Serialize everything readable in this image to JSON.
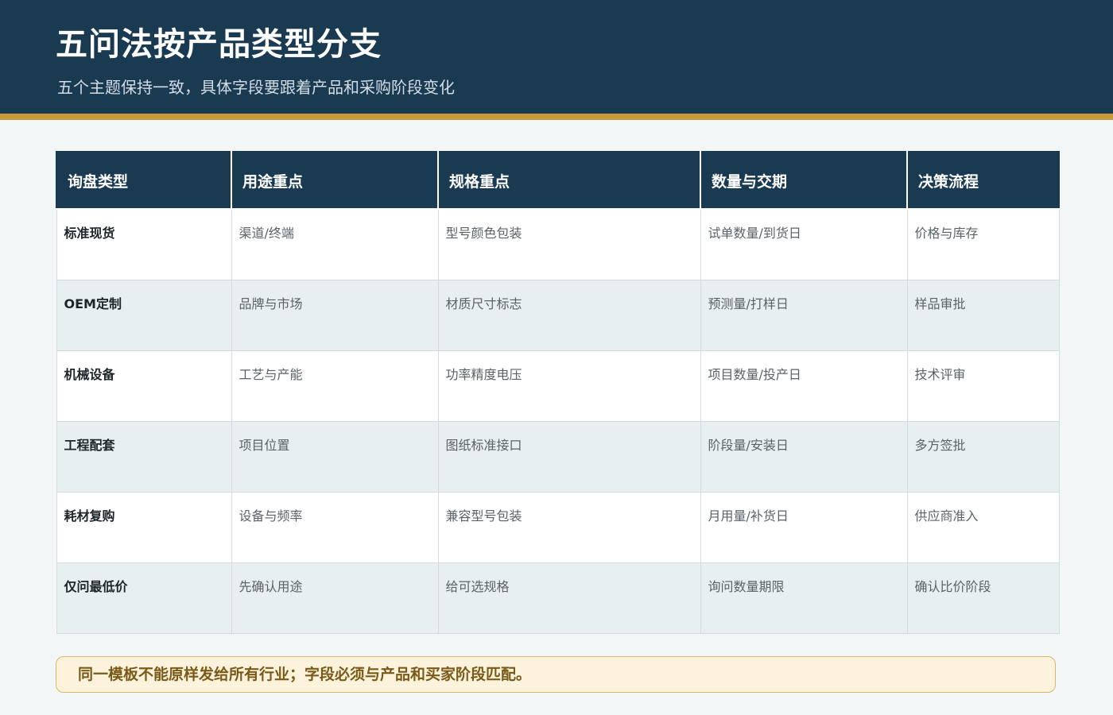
{
  "header": {
    "title": "五问法按产品类型分支",
    "subtitle": "五个主题保持一致，具体字段要跟着产品和采购阶段变化"
  },
  "table": {
    "columns": [
      "询盘类型",
      "用途重点",
      "规格重点",
      "数量与交期",
      "决策流程"
    ],
    "rows": [
      [
        "标准现货",
        "渠道/终端",
        "型号颜色包装",
        "试单数量/到货日",
        "价格与库存"
      ],
      [
        "OEM定制",
        "品牌与市场",
        "材质尺寸标志",
        "预测量/打样日",
        "样品审批"
      ],
      [
        "机械设备",
        "工艺与产能",
        "功率精度电压",
        "项目数量/投产日",
        "技术评审"
      ],
      [
        "工程配套",
        "项目位置",
        "图纸标准接口",
        "阶段量/安装日",
        "多方签批"
      ],
      [
        "耗材复购",
        "设备与频率",
        "兼容型号包装",
        "月用量/补货日",
        "供应商准入"
      ],
      [
        "仅问最低价",
        "先确认用途",
        "给可选规格",
        "询问数量期限",
        "确认比价阶段"
      ]
    ]
  },
  "note": {
    "text": "同一模板不能原样发给所有行业；字段必须与产品和买家阶段匹配。"
  },
  "colors": {
    "header_bg": "#1a3a52",
    "accent_gold": "#c99a3a",
    "row_alt_bg": "#e8eff1",
    "note_bg": "#fdf3dc",
    "note_text": "#7a5a18"
  }
}
